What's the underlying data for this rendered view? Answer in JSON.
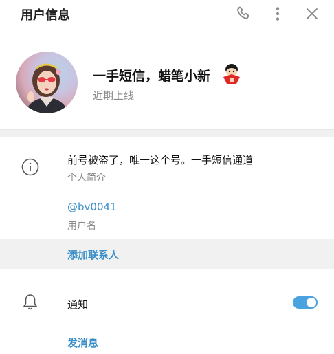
{
  "header": {
    "title": "用户信息",
    "icons": [
      "phone-icon",
      "more-vertical-icon",
      "close-icon"
    ]
  },
  "profile": {
    "name": "一手短信，蜡笔小新",
    "status": "近期上线"
  },
  "info": {
    "bio": "前号被盗了，唯一这个号。一手短信通道",
    "bio_label": "个人简介",
    "username": "@bv0041",
    "username_label": "用户名"
  },
  "actions": {
    "add_contact": "添加联系人",
    "notifications_label": "通知",
    "notifications_enabled": true,
    "send_message": "发消息"
  },
  "colors": {
    "accent": "#3a8fc8",
    "toggle": "#4aa3df",
    "muted": "#8a8a8a"
  }
}
